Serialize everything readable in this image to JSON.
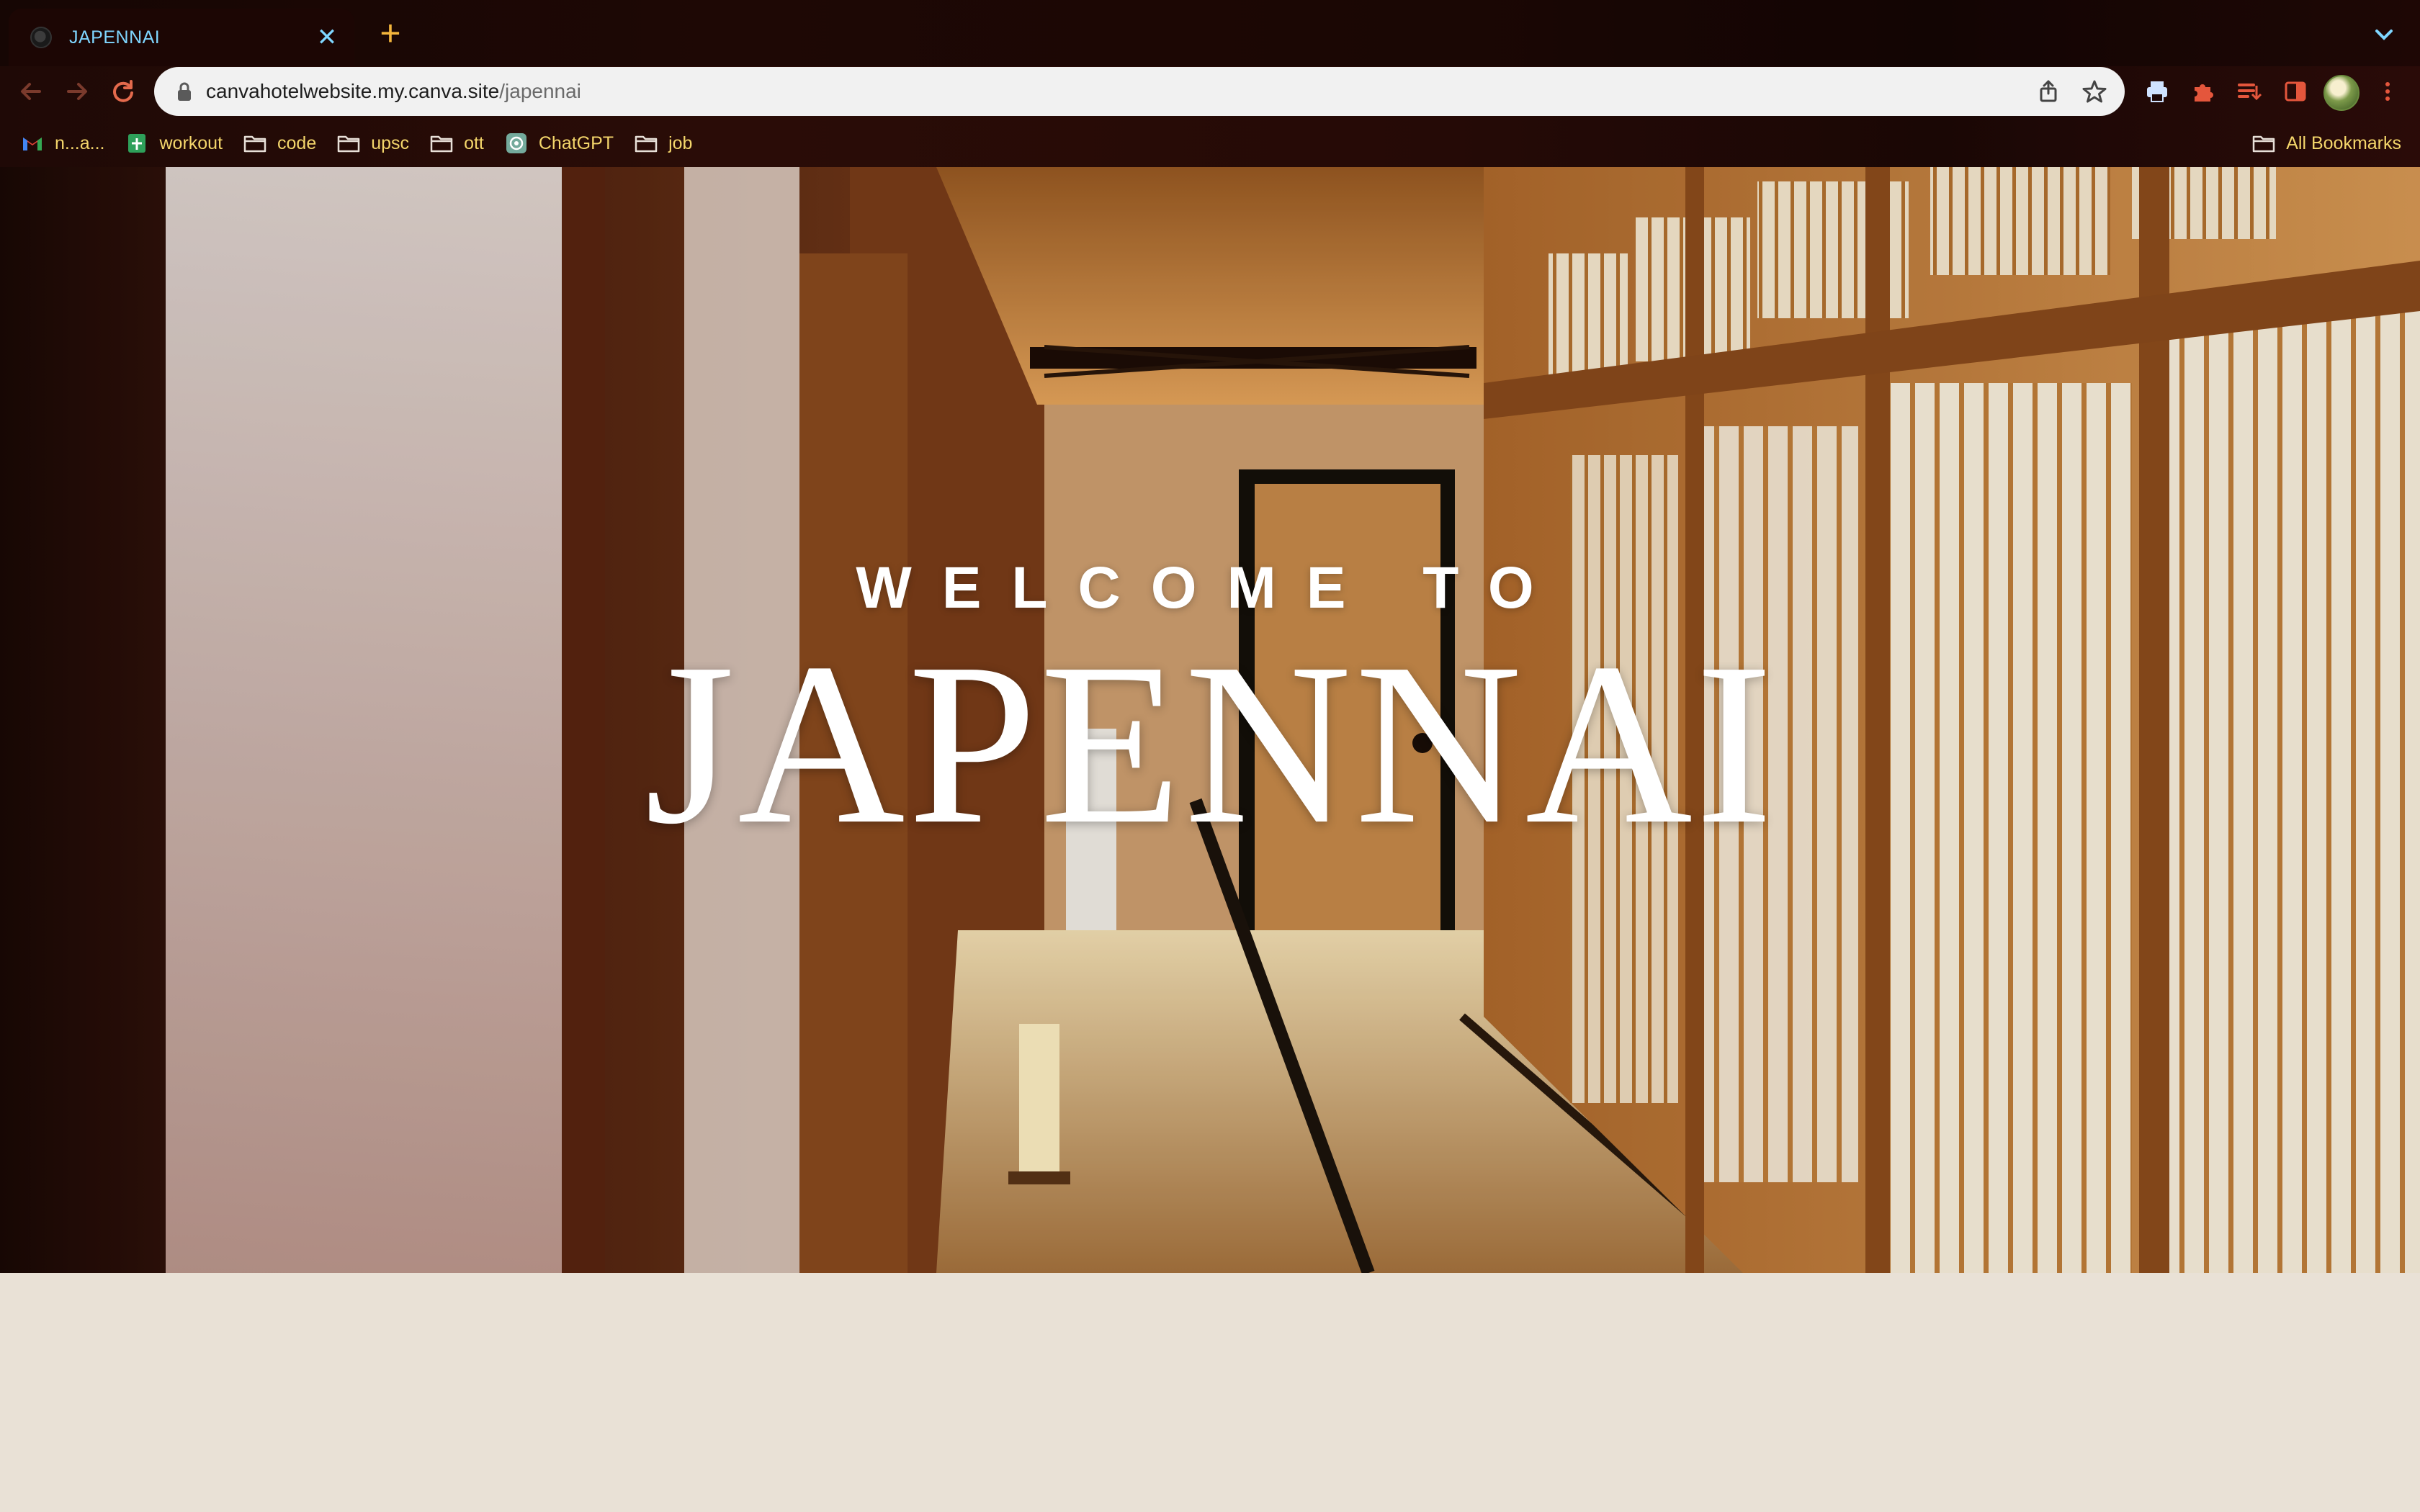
{
  "browser": {
    "tab": {
      "title": "JAPENNAI",
      "close_symbol": "✕"
    },
    "new_tab_symbol": "+",
    "url": {
      "domain": "canvahotelwebsite.my.canva.site",
      "path": "/japennai"
    },
    "bookmarks": [
      {
        "label": "n...a...",
        "icon": "gmail-icon"
      },
      {
        "label": "workout",
        "icon": "sheets-icon"
      },
      {
        "label": "code",
        "icon": "folder-icon"
      },
      {
        "label": "upsc",
        "icon": "folder-icon"
      },
      {
        "label": "ott",
        "icon": "folder-icon"
      },
      {
        "label": "ChatGPT",
        "icon": "chatgpt-icon"
      },
      {
        "label": "job",
        "icon": "folder-icon"
      }
    ],
    "all_bookmarks_label": "All Bookmarks",
    "colors": {
      "tab_text": "#7fd6ff",
      "bookmark_text": "#f4d66b",
      "accent": "#f4b53c"
    }
  },
  "hero": {
    "welcome_text": "WELCOME TO",
    "brand_name": "JAPENNAI",
    "background_image": "japanese-corridor-with-shoji-screens"
  },
  "page": {
    "background_color": "#e9e1d6"
  }
}
